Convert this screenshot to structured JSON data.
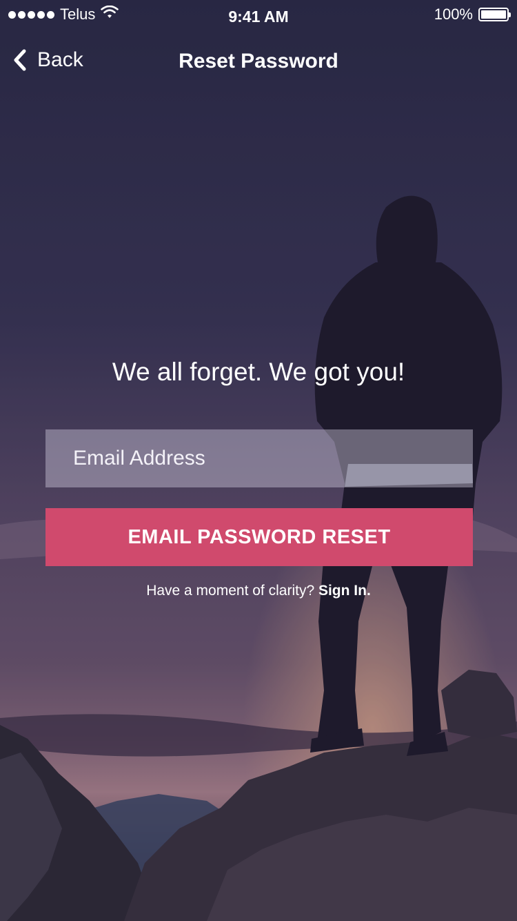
{
  "status_bar": {
    "carrier": "Telus",
    "time": "9:41 AM",
    "battery": "100%",
    "battery_level": 1.0,
    "signal_icon": "signal-dots-icon",
    "wifi_icon": "wifi-icon",
    "battery_icon": "battery-icon"
  },
  "nav": {
    "back_label": "Back",
    "back_icon": "chevron-left-icon",
    "title": "Reset Password"
  },
  "main": {
    "headline": "We all forget. We got you!",
    "email_placeholder": "Email Address",
    "email_value": "",
    "reset_button": "EMAIL PASSWORD RESET",
    "signin_prompt": "Have a moment of clarity?",
    "signin_link": "Sign In."
  },
  "colors": {
    "accent": "#d04a6d",
    "overlay": "#2c2a45"
  }
}
